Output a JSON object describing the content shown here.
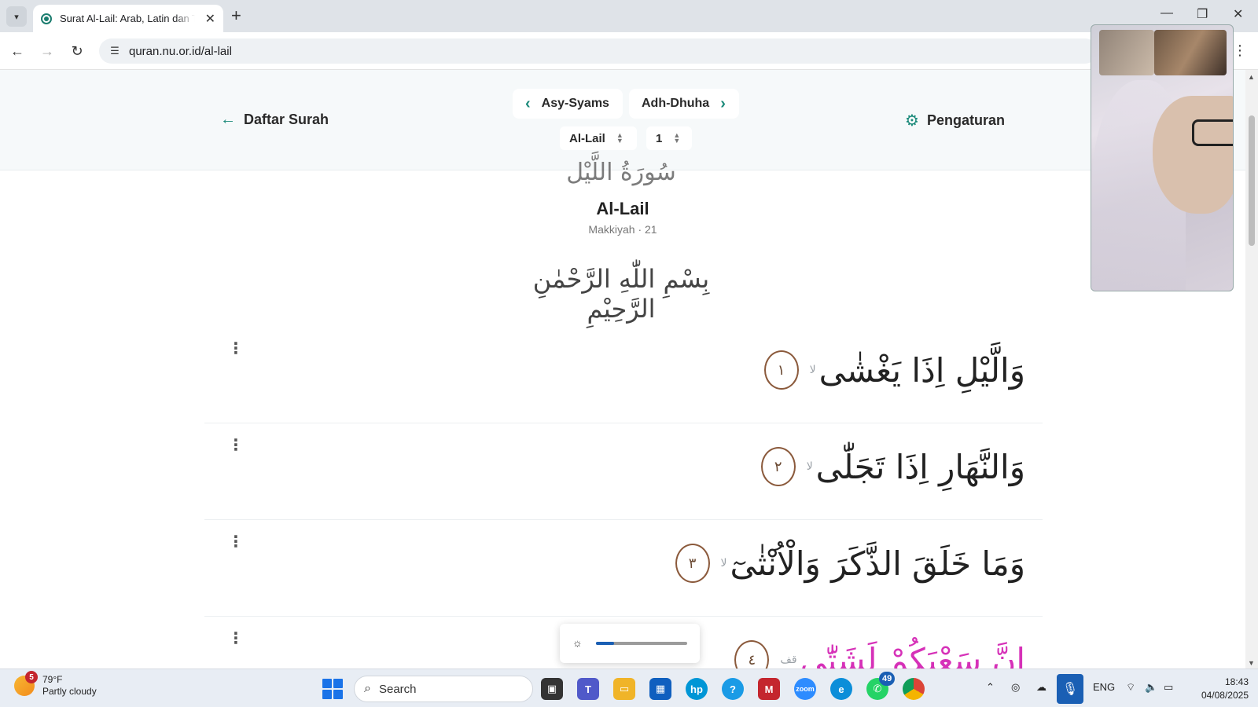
{
  "browser": {
    "tab_title": "Surat Al-Lail: Arab, Latin dan Terjemah",
    "url": "quran.nu.or.id/al-lail"
  },
  "header": {
    "back_label": "Daftar Surah",
    "prev_surah": "Asy-Syams",
    "next_surah": "Adh-Dhuha",
    "surah_select": "Al-Lail",
    "ayah_select": "1",
    "settings_label": "Pengaturan"
  },
  "surah": {
    "calligraphy": "سُورَةُ اللَّيْل",
    "name": "Al-Lail",
    "meta": "Makkiyah · 21",
    "basmalah": "بِسْمِ اللّٰهِ الرَّحْمٰنِ الرَّحِيْمِ"
  },
  "ayat": [
    {
      "number": "١",
      "text_main": "وَالَّيْلِ اِذَا يَغْشٰى",
      "mark": "لا"
    },
    {
      "number": "٢",
      "text_main": "وَالنَّهَارِ اِذَا تَجَلّٰى",
      "mark": "لا"
    },
    {
      "number": "٣",
      "text_main": "وَمَا خَلَقَ الذَّكَرَ وَالْاُنْثٰىٓ",
      "mark": "لا"
    },
    {
      "number": "٤",
      "text_main": "اِنَّ سَعْيَكُمْ لَشَتّٰى",
      "mark": "قف"
    }
  ],
  "brightness": {
    "level_percent": 20
  },
  "taskbar": {
    "weather_temp": "79°F",
    "weather_desc": "Partly cloudy",
    "weather_badge": "5",
    "search_label": "Search",
    "whatsapp_badge": "49",
    "lang": "ENG",
    "time": "18:43",
    "date": "04/08/2025"
  },
  "colors": {
    "accent": "#1b8a7a",
    "tajwid_pink": "#d631b8",
    "tajwid_green": "#2bb34a",
    "ayah_ring": "#8b5a3c"
  }
}
